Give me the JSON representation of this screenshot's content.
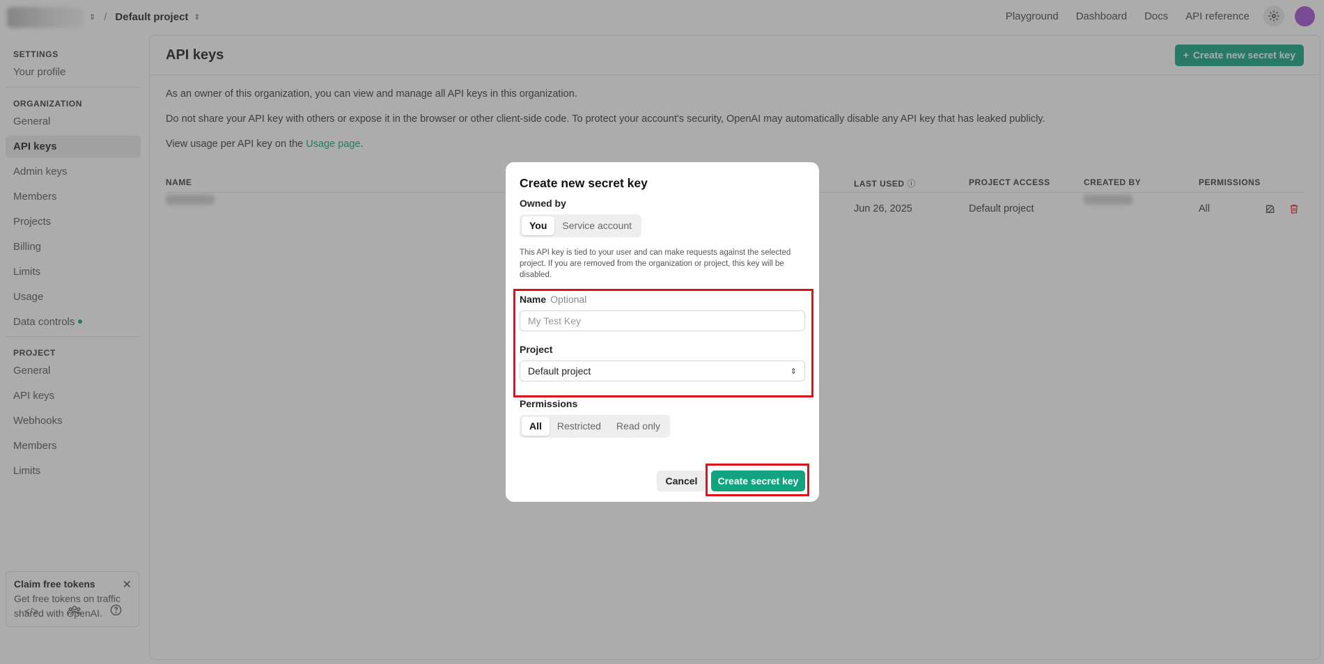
{
  "topbar": {
    "project_name": "Default project",
    "nav": [
      "Playground",
      "Dashboard",
      "Docs",
      "API reference"
    ]
  },
  "sidebar": {
    "settings_header": "SETTINGS",
    "your_profile": "Your profile",
    "organization_header": "ORGANIZATION",
    "org_items": [
      "General",
      "API keys",
      "Admin keys",
      "Members",
      "Projects",
      "Billing",
      "Limits",
      "Usage",
      "Data controls"
    ],
    "project_header": "PROJECT",
    "project_items": [
      "General",
      "API keys",
      "Webhooks",
      "Members",
      "Limits"
    ],
    "claim": {
      "title": "Claim free tokens",
      "text": "Get free tokens on traffic shared with OpenAI."
    }
  },
  "main": {
    "title": "API keys",
    "create_button": "Create new secret key",
    "info1": "As an owner of this organization, you can view and manage all API keys in this organization.",
    "info2": "Do not share your API key with others or expose it in the browser or other client-side code. To protect your account's security, OpenAI may automatically disable any API key that has leaked publicly.",
    "info3_prefix": "View usage per API key on the ",
    "info3_link": "Usage page",
    "info3_suffix": ".",
    "table": {
      "headers": [
        "NAME",
        "LAST USED",
        "PROJECT ACCESS",
        "CREATED BY",
        "PERMISSIONS"
      ],
      "row": {
        "last_used": "Jun 26, 2025",
        "project_access": "Default project",
        "permissions": "All"
      }
    }
  },
  "modal": {
    "title": "Create new secret key",
    "owned_by_label": "Owned by",
    "owned_options": [
      "You",
      "Service account"
    ],
    "description": "This API key is tied to your user and can make requests against the selected project. If you are removed from the organization or project, this key will be disabled.",
    "name_label": "Name",
    "name_optional": "Optional",
    "name_placeholder": "My Test Key",
    "project_label": "Project",
    "project_value": "Default project",
    "permissions_label": "Permissions",
    "permissions_options": [
      "All",
      "Restricted",
      "Read only"
    ],
    "cancel": "Cancel",
    "create": "Create secret key"
  }
}
